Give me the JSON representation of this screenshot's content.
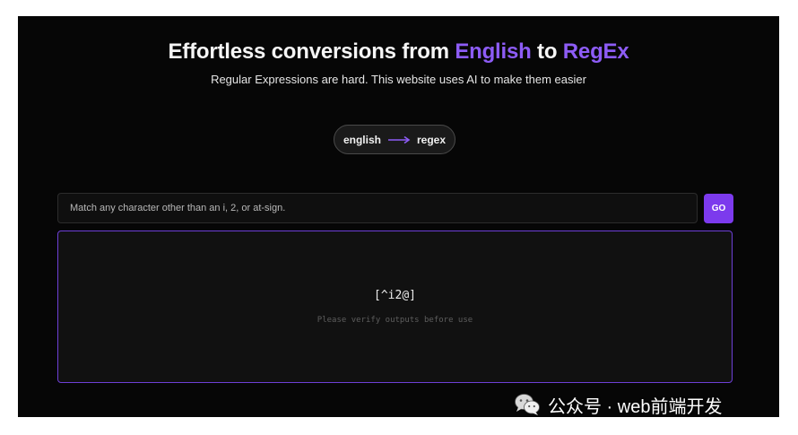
{
  "colors": {
    "background": "#060606",
    "accent": "#8d5cf6",
    "button": "#7c3aed",
    "output_border": "#6d3fd6"
  },
  "hero": {
    "title_prefix": "Effortless conversions from ",
    "title_from": "English",
    "title_middle": " to ",
    "title_to": "RegEx",
    "subtitle": "Regular Expressions are hard. This website uses AI to make them easier"
  },
  "mode_toggle": {
    "from_label": "english",
    "to_label": "regex",
    "arrow_icon": "long-arrow-right-icon"
  },
  "input": {
    "value": "Match any character other than an i, 2, or at-sign."
  },
  "go_button": {
    "label": "GO"
  },
  "output": {
    "regex": "[^i2@]",
    "note": "Please verify outputs before use"
  },
  "watermark": {
    "icon": "wechat-icon",
    "text": "公众号 · web前端开发"
  }
}
